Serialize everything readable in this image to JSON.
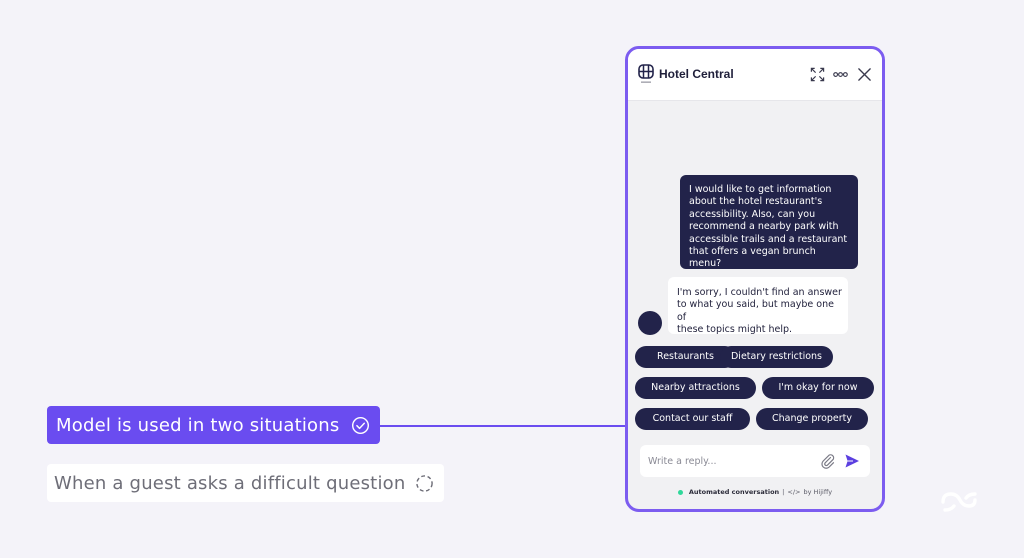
{
  "annotations": {
    "active_label": "Model is used in two situations",
    "inactive_label": "When a guest asks a difficult question"
  },
  "widget": {
    "title": "Hotel Central",
    "user_message": "I would like to get information\nabout the hotel restaurant's\naccessibility. Also, can you\nrecommend a nearby park with\naccessible trails and a restaurant\nthat offers a vegan brunch menu?",
    "bot_message": "I'm sorry, I couldn't find an answer\nto what you said, but maybe one of\nthese topics might help.",
    "chips": [
      "Restaurants",
      "Dietary restrictions",
      "Nearby attractions",
      "I'm okay for now",
      "Contact our staff",
      "Change property"
    ],
    "reply_placeholder": "Write a reply...",
    "footer_status": "Automated conversation",
    "footer_separator": "|",
    "footer_code": "</>",
    "footer_by": "by Hijiffy"
  },
  "colors": {
    "accent": "#6a4cf0",
    "widget_border": "#7c5cf0",
    "dark_navy": "#22234a",
    "status_green": "#2fd89a",
    "background": "#f4f3f9"
  },
  "icons": {
    "active_pill": "check-circle-icon",
    "inactive_pill": "loading-spinner-icon",
    "expand": "expand-icon",
    "more": "more-options-icon",
    "close": "close-icon",
    "attach": "paperclip-icon",
    "send": "send-icon",
    "hotel_logo": "hotel-logo-icon",
    "brand": "brand-logo-icon"
  }
}
